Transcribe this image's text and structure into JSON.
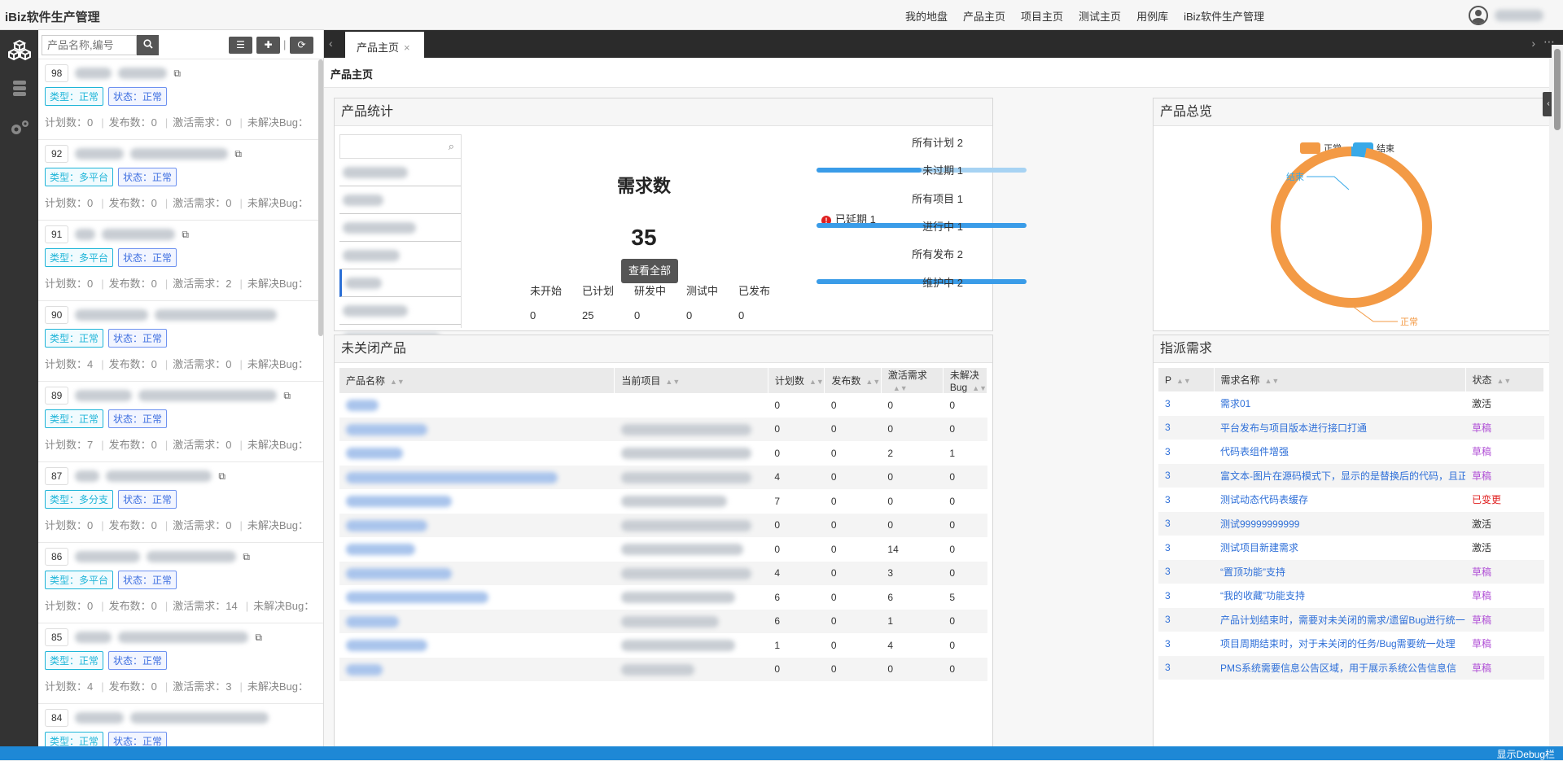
{
  "app": {
    "title": "iBiz软件生产管理"
  },
  "topnav": [
    "我的地盘",
    "产品主页",
    "项目主页",
    "测试主页",
    "用例库",
    "iBiz软件生产管理"
  ],
  "sidebar_search": {
    "placeholder": "产品名称,编号"
  },
  "products": [
    {
      "id": "98",
      "type": "类型：正常",
      "status": "状态：正常",
      "stats": {
        "plans": "计划数：0",
        "releases": "发布数：0",
        "active": "激活需求：0",
        "bugs": "未解决Bug："
      }
    },
    {
      "id": "92",
      "type": "类型：多平台",
      "status": "状态：正常",
      "stats": {
        "plans": "计划数：0",
        "releases": "发布数：0",
        "active": "激活需求：0",
        "bugs": "未解决Bug："
      }
    },
    {
      "id": "91",
      "type": "类型：多平台",
      "status": "状态：正常",
      "stats": {
        "plans": "计划数：0",
        "releases": "发布数：0",
        "active": "激活需求：2",
        "bugs": "未解决Bug："
      }
    },
    {
      "id": "90",
      "type": "类型：正常",
      "status": "状态：正常",
      "stats": {
        "plans": "计划数：4",
        "releases": "发布数：0",
        "active": "激活需求：0",
        "bugs": "未解决Bug："
      }
    },
    {
      "id": "89",
      "type": "类型：正常",
      "status": "状态：正常",
      "stats": {
        "plans": "计划数：7",
        "releases": "发布数：0",
        "active": "激活需求：0",
        "bugs": "未解决Bug："
      }
    },
    {
      "id": "87",
      "type": "类型：多分支",
      "status": "状态：正常",
      "stats": {
        "plans": "计划数：0",
        "releases": "发布数：0",
        "active": "激活需求：0",
        "bugs": "未解决Bug："
      }
    },
    {
      "id": "86",
      "type": "类型：多平台",
      "status": "状态：正常",
      "stats": {
        "plans": "计划数：0",
        "releases": "发布数：0",
        "active": "激活需求：14",
        "bugs": "未解决Bug："
      }
    },
    {
      "id": "85",
      "type": "类型：正常",
      "status": "状态：正常",
      "stats": {
        "plans": "计划数：4",
        "releases": "发布数：0",
        "active": "激活需求：3",
        "bugs": "未解决Bug："
      }
    },
    {
      "id": "84",
      "type": "类型：正常",
      "status": "状态：正常",
      "stats": {
        "plans": "",
        "releases": "",
        "active": "",
        "bugs": ""
      }
    }
  ],
  "tabs": {
    "active": "产品主页"
  },
  "breadcrumb": "产品主页",
  "product_stats": {
    "title": "产品统计",
    "req_title": "需求数",
    "req_count": "35",
    "view_all": "查看全部",
    "phase_labels": [
      "未开始",
      "已计划",
      "研发中",
      "测试中",
      "已发布"
    ],
    "phase_values": [
      "0",
      "25",
      "0",
      "0",
      "0"
    ],
    "all_plans": "所有计划  2",
    "unexpired": "未过期  1",
    "delayed": "已延期 1",
    "all_projects": "所有项目  1",
    "in_progress": "进行中  1",
    "all_releases": "所有发布  2",
    "maintaining": "维护中  2",
    "unexpired_ratio": 0.5,
    "in_progress_ratio": 1.0,
    "maintaining_ratio": 1.0
  },
  "overview": {
    "title": "产品总览",
    "legend": [
      "正常",
      "结束"
    ],
    "slice_labels": {
      "normal": "正常",
      "closed": "结束"
    },
    "colors": {
      "normal": "#f39a45",
      "closed": "#38a9e8"
    }
  },
  "chart_data": {
    "type": "pie",
    "categories": [
      "正常",
      "结束"
    ],
    "values": [
      97,
      3
    ],
    "title": "",
    "legend": "top-center"
  },
  "open_products": {
    "title": "未关闭产品",
    "headers": [
      "产品名称",
      "当前项目",
      "计划数",
      "发布数",
      "激活需求",
      "未解决Bug"
    ],
    "rows": [
      [
        "0",
        "0",
        "0",
        "0"
      ],
      [
        "0",
        "0",
        "0",
        "0"
      ],
      [
        "0",
        "0",
        "2",
        "1"
      ],
      [
        "4",
        "0",
        "0",
        "0"
      ],
      [
        "7",
        "0",
        "0",
        "0"
      ],
      [
        "0",
        "0",
        "0",
        "0"
      ],
      [
        "0",
        "0",
        "14",
        "0"
      ],
      [
        "4",
        "0",
        "3",
        "0"
      ],
      [
        "6",
        "0",
        "6",
        "5"
      ],
      [
        "6",
        "0",
        "1",
        "0"
      ],
      [
        "1",
        "0",
        "4",
        "0"
      ],
      [
        "0",
        "0",
        "0",
        "0"
      ]
    ]
  },
  "assigned": {
    "title": "指派需求",
    "headers": [
      "P",
      "需求名称",
      "状态"
    ],
    "rows": [
      {
        "p": "3",
        "name": "需求01",
        "status": "激活",
        "cls": "st-active"
      },
      {
        "p": "3",
        "name": "平台发布与项目版本进行接口打通",
        "status": "草稿",
        "cls": "st-draft"
      },
      {
        "p": "3",
        "name": "代码表组件增强",
        "status": "草稿",
        "cls": "st-draft"
      },
      {
        "p": "3",
        "name": "富文本-图片在源码模式下，显示的是替换后的代码，且正",
        "status": "草稿",
        "cls": "st-draft"
      },
      {
        "p": "3",
        "name": "测试动态代码表缓存",
        "status": "已变更",
        "cls": "st-chg"
      },
      {
        "p": "3",
        "name": "测试99999999999",
        "status": "激活",
        "cls": "st-active"
      },
      {
        "p": "3",
        "name": "测试项目新建需求",
        "status": "激活",
        "cls": "st-active"
      },
      {
        "p": "3",
        "name": "“置顶功能”支持",
        "status": "草稿",
        "cls": "st-draft"
      },
      {
        "p": "3",
        "name": "“我的收藏”功能支持",
        "status": "草稿",
        "cls": "st-draft"
      },
      {
        "p": "3",
        "name": "产品计划结束时，需要对未关闭的需求/遗留Bug进行统一",
        "status": "草稿",
        "cls": "st-draft"
      },
      {
        "p": "3",
        "name": "项目周期结束时，对于未关闭的任务/Bug需要统一处理",
        "status": "草稿",
        "cls": "st-draft"
      },
      {
        "p": "3",
        "name": "PMS系统需要信息公告区域，用于展示系统公告信息信",
        "status": "草稿",
        "cls": "st-draft"
      }
    ]
  },
  "footer": {
    "debug": "显示Debug栏"
  }
}
